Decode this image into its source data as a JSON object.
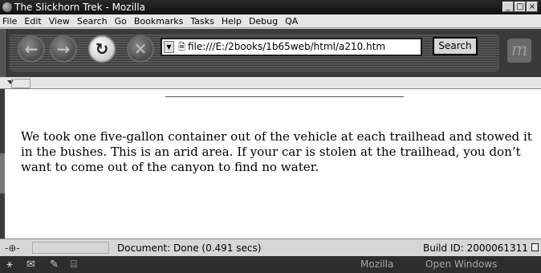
{
  "window": {
    "title": "The Slickhorn Trek - Mozilla",
    "controls": [
      "_",
      "□",
      "×"
    ]
  },
  "menu": [
    "File",
    "Edit",
    "View",
    "Search",
    "Go",
    "Bookmarks",
    "Tasks",
    "Help",
    "Debug",
    "QA"
  ],
  "toolbar": {
    "back_glyph": "←",
    "forward_glyph": "→",
    "reload_glyph": "↻",
    "stop_glyph": "✕",
    "url": "file:///E:/2books/1b65web/html/a210.htm",
    "search_label": "Search",
    "logo_glyph": "m"
  },
  "page": {
    "paragraph": "We took one five-gallon container out of the vehicle at each trailhead and stowed it in the bushes. This is an arid area. If your car is stolen at the trailhead, you don’t want to come out of the canyon to find no water."
  },
  "status": {
    "text": "Document: Done (0.491 secs)",
    "build": "Build ID: 2000061311"
  },
  "taskbar": {
    "mozilla_label": "Mozilla",
    "windows_label": "Open Windows"
  },
  "colors": {
    "titlebar": "#1c1c1c",
    "toolbar": "#3a3a3a",
    "content_bg": "#ffffff"
  }
}
